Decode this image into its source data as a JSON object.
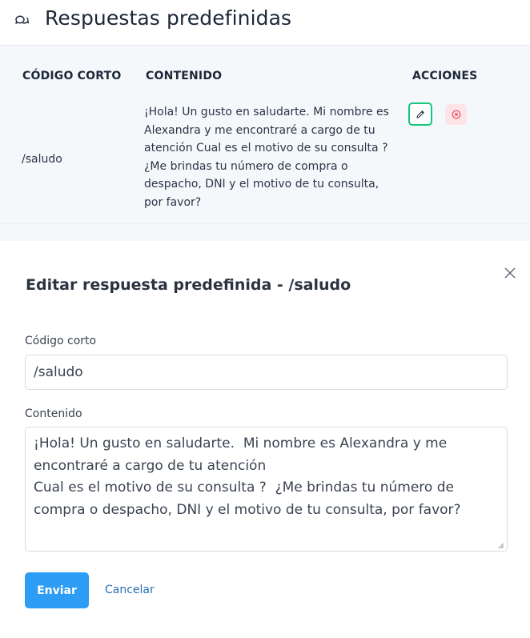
{
  "header": {
    "icon": "chat-bubbles-icon",
    "title": "Respuestas predefinidas"
  },
  "table": {
    "columns": [
      "CÓDIGO CORTO",
      "CONTENIDO",
      "ACCIONES"
    ],
    "rows": [
      {
        "code": "/saludo",
        "content_lines": [
          "¡Hola! Un gusto en saludarte. Mi nombre es",
          "Alexandra y me encontraré a cargo de tu",
          "atención Cual es el motivo de su consulta ?",
          "¿Me brindas tu número de compra o",
          "despacho, DNI y el motivo de tu consulta,",
          "por favor?"
        ],
        "actions": [
          "pencil-icon",
          "x-circle-icon"
        ]
      }
    ]
  },
  "modal": {
    "title": "Editar respuesta predefinida - /saludo",
    "close_icon": "close-icon",
    "code_label": "Código corto",
    "code_value": "/saludo",
    "content_label": "Contenido",
    "content_value": "¡Hola! Un gusto en saludarte.  Mi nombre es Alexandra y me encontraré a cargo de tu atención\nCual es el motivo de su consulta ?  ¿Me brindas tu número de compra o despacho, DNI y el motivo de tu consulta, por favor?",
    "submit_label": "Enviar",
    "cancel_label": "Cancelar"
  },
  "colors": {
    "accent": "#2d9cf5",
    "edit_border": "#17c67e",
    "delete_bg": "#fde4e7",
    "delete_icon": "#e8455a",
    "table_bg": "#f5f8fb"
  }
}
